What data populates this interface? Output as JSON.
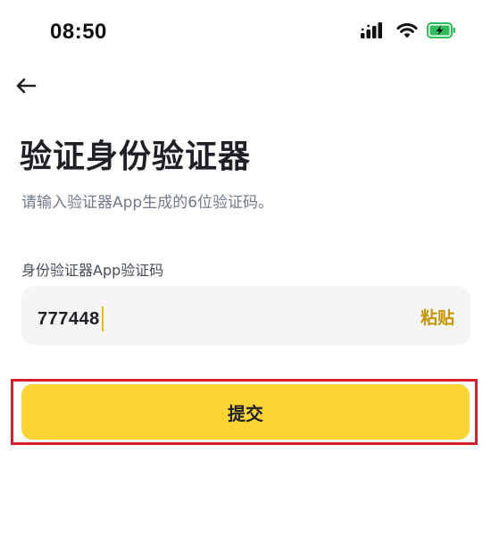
{
  "status_bar": {
    "time": "08:50",
    "icons": [
      "signal-icon",
      "wifi-icon",
      "battery-charging-icon"
    ],
    "battery_color": "#2dbd5a"
  },
  "header": {
    "back_icon": "arrow-left-icon"
  },
  "page": {
    "title": "验证身份验证器",
    "subtitle": "请输入验证器App生成的6位验证码。"
  },
  "form": {
    "code_label": "身份验证器App验证码",
    "code_value": "777448",
    "paste_label": "粘贴",
    "submit_label": "提交"
  },
  "colors": {
    "accent": "#fcd535",
    "accent_text": "#c99400",
    "highlight": "#d9202a",
    "input_bg": "#f5f5f5"
  }
}
